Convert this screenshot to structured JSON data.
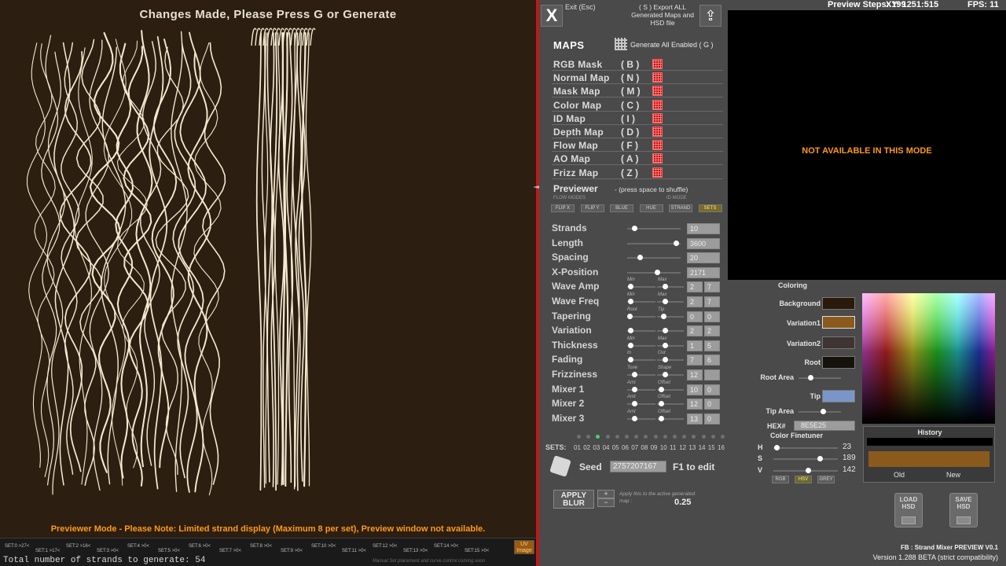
{
  "viewport": {
    "header": "Changes Made, Please Press G or Generate",
    "note": "Previewer Mode - Please Note: Limited strand display (Maximum 8 per set), Preview window not available.",
    "total_strands": "Total number of strands to generate: 54",
    "uv_badge": "UV Image",
    "uv_note": "Manual Set placement and curve control coming soon",
    "strand_color": "#f3ead0",
    "bg_color": "#2c1e10",
    "sets": [
      "SET:0 >27<",
      "SET:1 >17<",
      "SET:2 >16<",
      "SET:3 >0<",
      "SET:4 >0<",
      "SET:5 >0<",
      "SET:6 >0<",
      "SET:7 >0<",
      "SET:8 >0<",
      "SET:9 >0<",
      "SET:10 >0<",
      "SET:11 >0<",
      "SET:12 >0<",
      "SET:13 >0<",
      "SET:14 >0<",
      "SET:15 >0<"
    ]
  },
  "topbar": {
    "preview_steps": "Preview Steps: 199",
    "xy": "XY: 1251:515",
    "fps": "FPS: 11"
  },
  "header_buttons": {
    "exit_icon": "X",
    "exit_label": "Exit (Esc)",
    "export_label": "( S ) Export ALL Generated Maps and HSD file",
    "export_icon": "⇪"
  },
  "maps": {
    "title": "MAPS",
    "generate_all": "Generate All Enabled ( G )",
    "items": [
      {
        "name": "RGB Mask",
        "key": "( B )"
      },
      {
        "name": "Normal Map",
        "key": "( N )"
      },
      {
        "name": "Mask Map",
        "key": "( M )"
      },
      {
        "name": "Color Map",
        "key": "( C )"
      },
      {
        "name": "ID Map",
        "key": "( I )"
      },
      {
        "name": "Depth Map",
        "key": "( D )"
      },
      {
        "name": "Flow Map",
        "key": "( F )"
      },
      {
        "name": "AO Map",
        "key": "( A )"
      },
      {
        "name": "Frizz Map",
        "key": "( Z )"
      }
    ]
  },
  "previewer": {
    "label": "Previewer",
    "hint": "- (press space to shuffle)",
    "flow_modes_label": "FLOW MODES",
    "id_mode_label": "ID MODE",
    "modes": [
      "FLIP X",
      "FLIP Y",
      "BLUE",
      "HUE",
      "STRAND",
      "SETS"
    ],
    "active_mode": "SETS"
  },
  "params": [
    {
      "label": "Strands",
      "values": [
        "10"
      ]
    },
    {
      "label": "Length",
      "values": [
        "3600"
      ]
    },
    {
      "label": "Spacing",
      "values": [
        "20"
      ]
    },
    {
      "label": "X-Position",
      "values": [
        "2171"
      ]
    },
    {
      "label": "Wave Amp",
      "values": [
        "2",
        "7"
      ],
      "caps": [
        "Min",
        "Max"
      ]
    },
    {
      "label": "Wave Freq",
      "values": [
        "2",
        "7"
      ],
      "caps": [
        "Min",
        "Max"
      ]
    },
    {
      "label": "Tapering",
      "values": [
        "0",
        "0"
      ],
      "caps": [
        "Root",
        "Tip"
      ]
    },
    {
      "label": "Variation",
      "values": [
        "2",
        "2"
      ],
      "caps": [
        "",
        ""
      ]
    },
    {
      "label": "Thickness",
      "values": [
        "1",
        "5"
      ],
      "caps": [
        "Min",
        "Max"
      ]
    },
    {
      "label": "Fading",
      "values": [
        "7",
        "6"
      ],
      "caps": [
        "In",
        "Out"
      ]
    },
    {
      "label": "Frizziness",
      "values": [
        "12",
        ""
      ],
      "caps": [
        "Tone",
        "Shape"
      ]
    },
    {
      "label": "Mixer 1",
      "values": [
        "10",
        "0"
      ],
      "caps": [
        "Amt",
        "Offset"
      ]
    },
    {
      "label": "Mixer 2",
      "values": [
        "12",
        "0"
      ],
      "caps": [
        "Amt",
        "Offset"
      ]
    },
    {
      "label": "Mixer 3",
      "values": [
        "13",
        "0"
      ],
      "caps": [
        "Amt",
        "Offset"
      ]
    }
  ],
  "sets_bar": {
    "label": "SETS:",
    "numbers": [
      "01",
      "02",
      "03",
      "04",
      "05",
      "06",
      "07",
      "08",
      "09",
      "10",
      "11",
      "12",
      "13",
      "14",
      "15",
      "16"
    ],
    "active_index": 2
  },
  "seed": {
    "label": "Seed",
    "value": "2757207167",
    "edit_hint": "F1 to edit"
  },
  "blur": {
    "button": "APPLY BLUR",
    "plus": "+",
    "minus": "−",
    "hint": "Apply this to the active generated map :",
    "value": "0.25"
  },
  "preview_window": {
    "message": "NOT AVAILABLE IN THIS MODE"
  },
  "coloring": {
    "title": "Coloring",
    "background": {
      "label": "Background",
      "color": "#2a1a0c"
    },
    "variation1": {
      "label": "Variation1",
      "color": "#8a5a1c"
    },
    "variation2": {
      "label": "Variation2",
      "color": "#3e3432"
    },
    "root": {
      "label": "Root",
      "color": "#15120c"
    },
    "root_area": "Root Area",
    "tip": {
      "label": "Tip",
      "color": "#7a96c8"
    },
    "tip_area": "Tip Area",
    "hex_label": "HEX#",
    "hex_value": "8E5E25",
    "finetuner": "Color Finetuner",
    "h": {
      "label": "H",
      "value": "23"
    },
    "s": {
      "label": "S",
      "value": "189"
    },
    "v": {
      "label": "V",
      "value": "142"
    },
    "modes": [
      "RGB",
      "HSV",
      "GREY"
    ],
    "active_mode": "HSV"
  },
  "history": {
    "title": "History",
    "old": "Old",
    "new": "New",
    "old_color": "#8a5a1c"
  },
  "hsd": {
    "load": "LOAD HSD",
    "save": "SAVE HSD"
  },
  "footer": {
    "app_title": "FB : Strand Mixer PREVIEW V0.1",
    "version": "Version 1.288 BETA (strict compatibility)"
  }
}
